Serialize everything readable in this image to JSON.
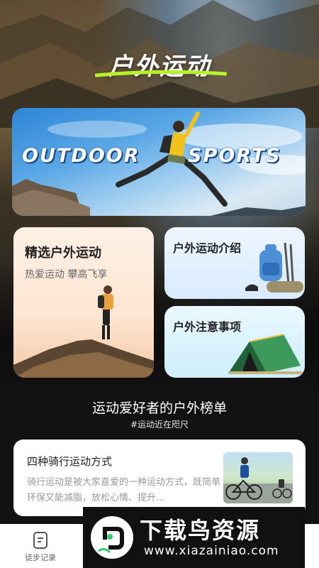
{
  "header": {
    "title": "户外运动"
  },
  "banner": {
    "left_text": "OUTDOOR",
    "right_text": "SPORTS"
  },
  "cards": {
    "featured": {
      "title": "精选户外运动",
      "subtitle": "热爱运动 攀高飞享"
    },
    "intro": {
      "title": "户外运动介绍"
    },
    "notice": {
      "title": "户外注意事项"
    }
  },
  "ranking": {
    "title": "运动爱好者的户外榜单",
    "tag": "#运动近在咫尺"
  },
  "article": {
    "title": "四种骑行运动方式",
    "body": "骑行运动是被大家喜爱的一种运动方式，既简单环保又能减脂，放松心情、提升..."
  },
  "tabbar": {
    "tab1_label": "徒步记录"
  },
  "watermark": {
    "brand": "下载鸟资源",
    "url": "www.xiazainiao.com"
  },
  "colors": {
    "accent_green": "#b6f22a",
    "background": "#141414"
  }
}
